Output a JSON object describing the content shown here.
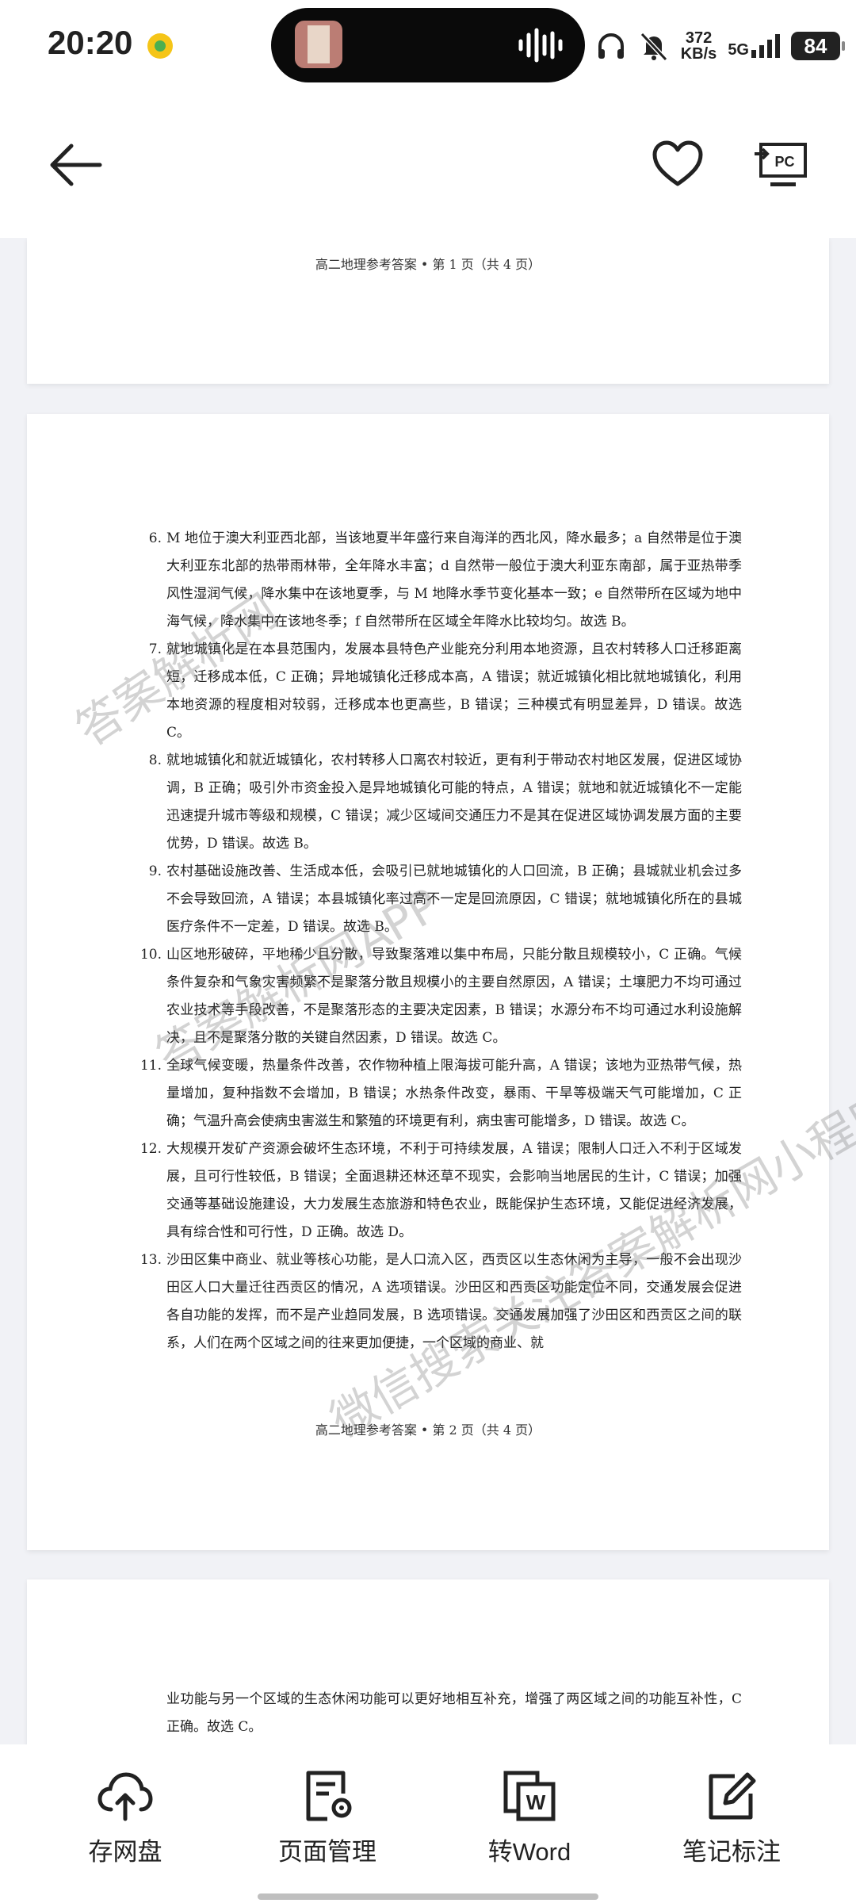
{
  "status_bar": {
    "time": "20:20",
    "net_speed_value": "372",
    "net_speed_unit": "KB/s",
    "network": "5G",
    "battery": "84"
  },
  "header": {},
  "document": {
    "page1": {
      "footer": "高二地理参考答案 • 第 1 页（共 4 页）"
    },
    "page2": {
      "footer": "高二地理参考答案 • 第 2 页（共 4 页）",
      "items": [
        {
          "num": "6.",
          "text": "M 地位于澳大利亚西北部，当该地夏半年盛行来自海洋的西北风，降水最多；a 自然带是位于澳大利亚东北部的热带雨林带，全年降水丰富；d 自然带一般位于澳大利亚东南部，属于亚热带季风性湿润气候，降水集中在该地夏季，与 M 地降水季节变化基本一致；e 自然带所在区域为地中海气候，降水集中在该地冬季；f 自然带所在区域全年降水比较均匀。故选 B。"
        },
        {
          "num": "7.",
          "text": "就地城镇化是在本县范围内，发展本县特色产业能充分利用本地资源，且农村转移人口迁移距离短，迁移成本低，C 正确；异地城镇化迁移成本高，A 错误；就近城镇化相比就地城镇化，利用本地资源的程度相对较弱，迁移成本也更高些，B 错误；三种模式有明显差异，D 错误。故选 C。"
        },
        {
          "num": "8.",
          "text": "就地城镇化和就近城镇化，农村转移人口离农村较近，更有利于带动农村地区发展，促进区域协调，B 正确；吸引外市资金投入是异地城镇化可能的特点，A 错误；就地和就近城镇化不一定能迅速提升城市等级和规模，C 错误；减少区域间交通压力不是其在促进区域协调发展方面的主要优势，D 错误。故选 B。"
        },
        {
          "num": "9.",
          "text": "农村基础设施改善、生活成本低，会吸引已就地城镇化的人口回流，B 正确；县城就业机会过多不会导致回流，A 错误；本县城镇化率过高不一定是回流原因，C 错误；就地城镇化所在的县城医疗条件不一定差，D 错误。故选 B。"
        },
        {
          "num": "10.",
          "text": "山区地形破碎，平地稀少且分散，导致聚落难以集中布局，只能分散且规模较小，C 正确。气候条件复杂和气象灾害频繁不是聚落分散且规模小的主要自然原因，A 错误；土壤肥力不均可通过农业技术等手段改善，不是聚落形态的主要决定因素，B 错误；水源分布不均可通过水利设施解决，且不是聚落分散的关键自然因素，D 错误。故选 C。"
        },
        {
          "num": "11.",
          "text": "全球气候变暖，热量条件改善，农作物种植上限海拔可能升高，A 错误；该地为亚热带气候，热量增加，复种指数不会增加，B 错误；水热条件改变，暴雨、干旱等极端天气可能增加，C 正确；气温升高会使病虫害滋生和繁殖的环境更有利，病虫害可能增多，D 错误。故选 C。"
        },
        {
          "num": "12.",
          "text": "大规模开发矿产资源会破坏生态环境，不利于可持续发展，A 错误；限制人口迁入不利于区域发展，且可行性较低，B 错误；全面退耕还林还草不现实，会影响当地居民的生计，C 错误；加强交通等基础设施建设，大力发展生态旅游和特色农业，既能保护生态环境，又能促进经济发展，具有综合性和可行性，D 正确。故选 D。"
        },
        {
          "num": "13.",
          "text": "沙田区集中商业、就业等核心功能，是人口流入区，西贡区以生态休闲为主导，一般不会出现沙田区人口大量迁往西贡区的情况，A 选项错误。沙田区和西贡区功能定位不同，交通发展会促进各自功能的发挥，而不是产业趋同发展，B 选项错误。交通发展加强了沙田区和西贡区之间的联系，人们在两个区域之间的往来更加便捷，一个区域的商业、就"
        }
      ]
    },
    "page3": {
      "text": "业功能与另一个区域的生态休闲功能可以更好地相互补充，增强了两区域之间的功能互补性，C 正确。故选 C。"
    }
  },
  "watermarks": [
    "答案解析网",
    "答案解析网APP",
    "微信搜索关注答案解析网小程序"
  ],
  "toolbar": [
    {
      "label": "存网盘",
      "icon": "cloud-upload-icon"
    },
    {
      "label": "页面管理",
      "icon": "page-settings-icon"
    },
    {
      "label": "转Word",
      "icon": "word-convert-icon"
    },
    {
      "label": "笔记标注",
      "icon": "edit-note-icon"
    }
  ]
}
